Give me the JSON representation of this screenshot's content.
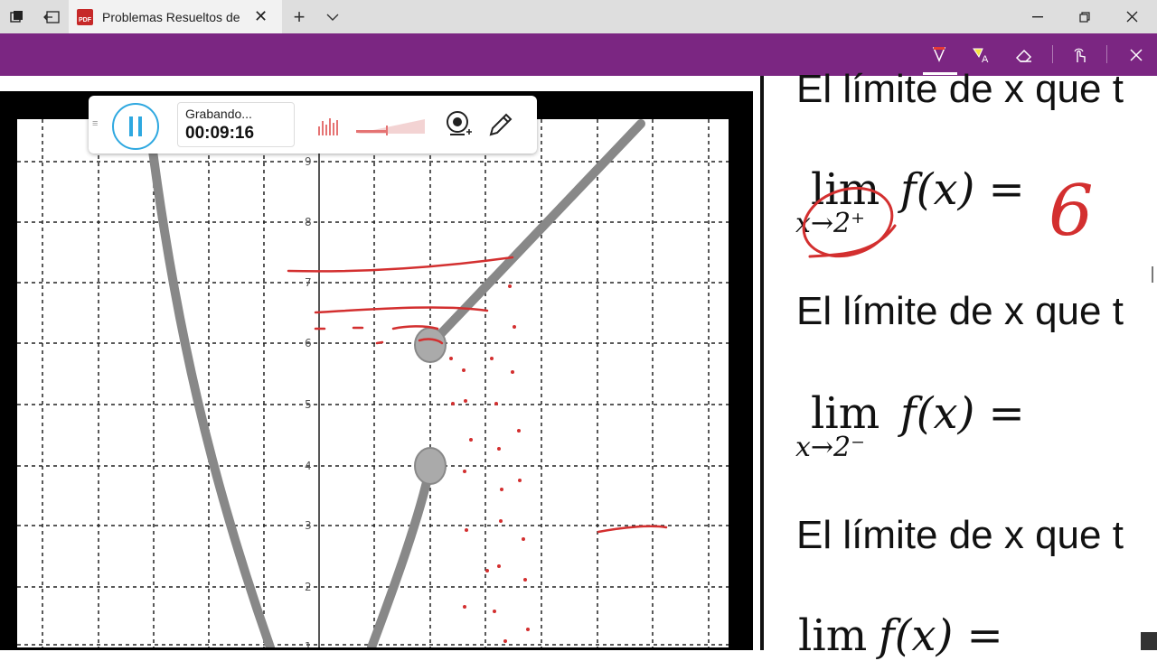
{
  "browser": {
    "tab_title": "Problemas Resueltos de",
    "tab_icon": "pdf-icon",
    "new_tab": "+",
    "accent_color": "#7b2682"
  },
  "recorder": {
    "status_label": "Grabando...",
    "elapsed_time": "00:09:16",
    "accent_color": "#2ea8e0"
  },
  "document": {
    "line1": "El límite de x que t",
    "line2": "El límite de x que t",
    "line3": "El límite de x que t",
    "lim_word": "lim",
    "fx_expr": "f(x) =",
    "sub_right": "x→2⁺",
    "sub_left": "x→2⁻",
    "handwritten_answer": "6"
  },
  "graph": {
    "y_ticks": [
      "9",
      "8",
      "7",
      "6",
      "5",
      "4",
      "3",
      "2",
      "1"
    ]
  }
}
